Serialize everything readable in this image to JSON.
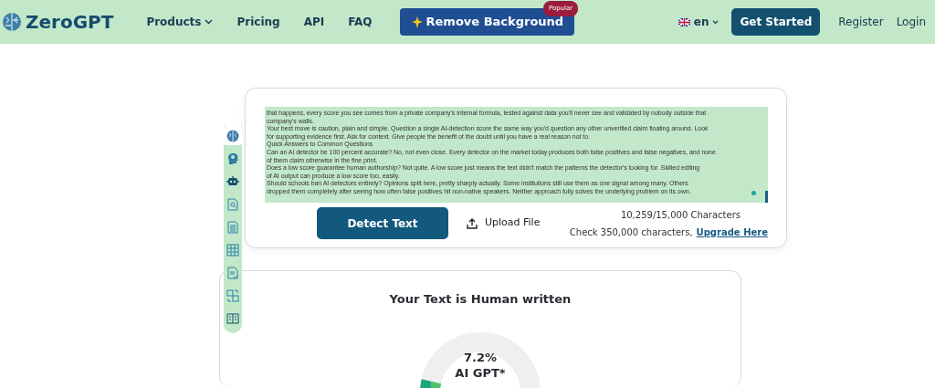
{
  "navbar": {
    "logo": "ZeroGPT",
    "items": [
      {
        "label": "Products",
        "dropdown": true
      },
      {
        "label": "Pricing",
        "dropdown": false
      },
      {
        "label": "API",
        "dropdown": false
      },
      {
        "label": "FAQ",
        "dropdown": false
      }
    ],
    "promo_button": {
      "label": "Remove Background",
      "badge": "Popular"
    },
    "language": "en",
    "get_started": "Get Started",
    "register": "Register",
    "login": "Login"
  },
  "tools": [
    {
      "kind": "brain",
      "selected": true
    },
    {
      "kind": "head",
      "selected": false
    },
    {
      "kind": "robot",
      "selected": false
    },
    {
      "kind": "search-doc",
      "selected": false
    },
    {
      "kind": "doc",
      "selected": false
    },
    {
      "kind": "grid",
      "selected": false
    },
    {
      "kind": "check-doc",
      "selected": false
    },
    {
      "kind": "translate",
      "selected": false
    },
    {
      "kind": "columns",
      "selected": false
    }
  ],
  "editor": {
    "lines": [
      "that happens, every score you see comes from a private company's internal formula, tested against data you'll never see and validated by nobody outside that",
      "company's walls.",
      "Your best move is caution, plain and simple. Question a single AI-detection score the same way you'd question any other unverified claim floating around. Look",
      "for supporting evidence first. Ask for context. Give people the benefit of the doubt until you have a real reason not to.",
      "Quick Answers to Common Questions",
      "Can an AI detector be 100 percent accurate? No, not even close. Every detector on the market today produces both false positives and false negatives, and none",
      "of them claim otherwise in the fine print.",
      "Does a low score guarantee human authorship? Not quite. A low score just means the text didn't match the patterns the detector's looking for. Skilled editing",
      "of AI output can produce a low score too, easily.",
      "Should schools ban AI detectors entirely? Opinions split here, pretty sharply actually. Some institutions still use them as one signal among many. Others",
      "dropped them completely after seeing how often false positives hit non-native speakers. Neither approach fully solves the underlying problem on its own."
    ],
    "detect_button": "Detect Text",
    "upload_button": "Upload File",
    "char_count": "10,259/15,000 Characters",
    "upgrade_text": "Check 350,000 characters,",
    "upgrade_link": "Upgrade Here"
  },
  "result": {
    "title": "Your Text is Human written",
    "gauge": {
      "value": "7.2%",
      "label": "AI GPT*"
    }
  }
}
